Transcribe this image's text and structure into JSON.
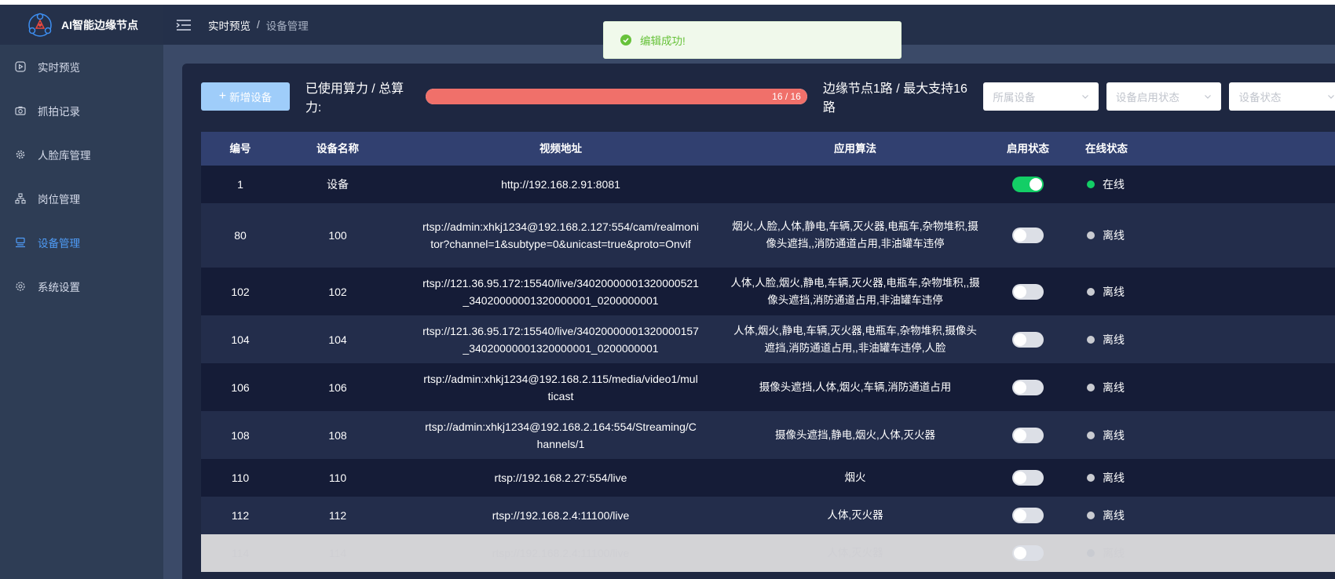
{
  "app": {
    "title": "AI智能边缘节点"
  },
  "sidebar": {
    "items": [
      {
        "label": "实时预览",
        "icon": "play-circle-icon",
        "active": false
      },
      {
        "label": "抓拍记录",
        "icon": "camera-icon",
        "active": false
      },
      {
        "label": "人脸库管理",
        "icon": "gear-icon",
        "active": false
      },
      {
        "label": "岗位管理",
        "icon": "org-chart-icon",
        "active": false
      },
      {
        "label": "设备管理",
        "icon": "device-icon",
        "active": true
      },
      {
        "label": "系统设置",
        "icon": "settings-icon",
        "active": false
      }
    ]
  },
  "breadcrumb": {
    "parent": "实时预览",
    "separator": "/",
    "current": "设备管理"
  },
  "toast": {
    "message": "编辑成功!",
    "type": "success"
  },
  "toolbar": {
    "add_label": "新增设备",
    "compute_label": "已使用算力 / 总算力:",
    "progress": {
      "used": 16,
      "total": 16,
      "text": "16 / 16"
    },
    "edge_label": "边缘节点1路 / 最大支持16路",
    "filters": [
      {
        "placeholder": "所属设备"
      },
      {
        "placeholder": "设备启用状态"
      },
      {
        "placeholder": "设备状态"
      }
    ]
  },
  "table": {
    "columns": [
      "编号",
      "设备名称",
      "视频地址",
      "应用算法",
      "启用状态",
      "在线状态"
    ],
    "rows": [
      {
        "id": "1",
        "name": "设备",
        "url": "http://192.168.2.91:8081",
        "algorithms": "",
        "enabled": true,
        "status": "在线"
      },
      {
        "id": "80",
        "name": "100",
        "url": "rtsp://admin:xhkj1234@192.168.2.127:554/cam/realmonitor?channel=1&subtype=0&unicast=true&proto=Onvif",
        "algorithms": "烟火,人脸,人体,静电,车辆,灭火器,电瓶车,杂物堆积,摄像头遮挡,,消防通道占用,非油罐车违停",
        "enabled": false,
        "status": "离线"
      },
      {
        "id": "102",
        "name": "102",
        "url": "rtsp://121.36.95.172:15540/live/34020000001320000521_34020000001320000001_0200000001",
        "algorithms": "人体,人脸,烟火,静电,车辆,灭火器,电瓶车,杂物堆积,,摄像头遮挡,消防通道占用,非油罐车违停",
        "enabled": false,
        "status": "离线"
      },
      {
        "id": "104",
        "name": "104",
        "url": "rtsp://121.36.95.172:15540/live/34020000001320000157_34020000001320000001_0200000001",
        "algorithms": "人体,烟火,静电,车辆,灭火器,电瓶车,杂物堆积,摄像头遮挡,消防通道占用,,非油罐车违停,人脸",
        "enabled": false,
        "status": "离线"
      },
      {
        "id": "106",
        "name": "106",
        "url": "rtsp://admin:xhkj1234@192.168.2.115/media/video1/multicast",
        "algorithms": "摄像头遮挡,人体,烟火,车辆,消防通道占用",
        "enabled": false,
        "status": "离线"
      },
      {
        "id": "108",
        "name": "108",
        "url": "rtsp://admin:xhkj1234@192.168.2.164:554/Streaming/Channels/1",
        "algorithms": "摄像头遮挡,静电,烟火,人体,灭火器",
        "enabled": false,
        "status": "离线"
      },
      {
        "id": "110",
        "name": "110",
        "url": "rtsp://192.168.2.27:554/live",
        "algorithms": "烟火",
        "enabled": false,
        "status": "离线"
      },
      {
        "id": "112",
        "name": "112",
        "url": "rtsp://192.168.2.4:11100/live",
        "algorithms": "人体,灭火器",
        "enabled": false,
        "status": "离线"
      },
      {
        "id": "114",
        "name": "114",
        "url": "rtsp://192.168.2.4:11100/live",
        "algorithms": "人体,灭火器",
        "enabled": false,
        "status": "离线"
      }
    ]
  }
}
